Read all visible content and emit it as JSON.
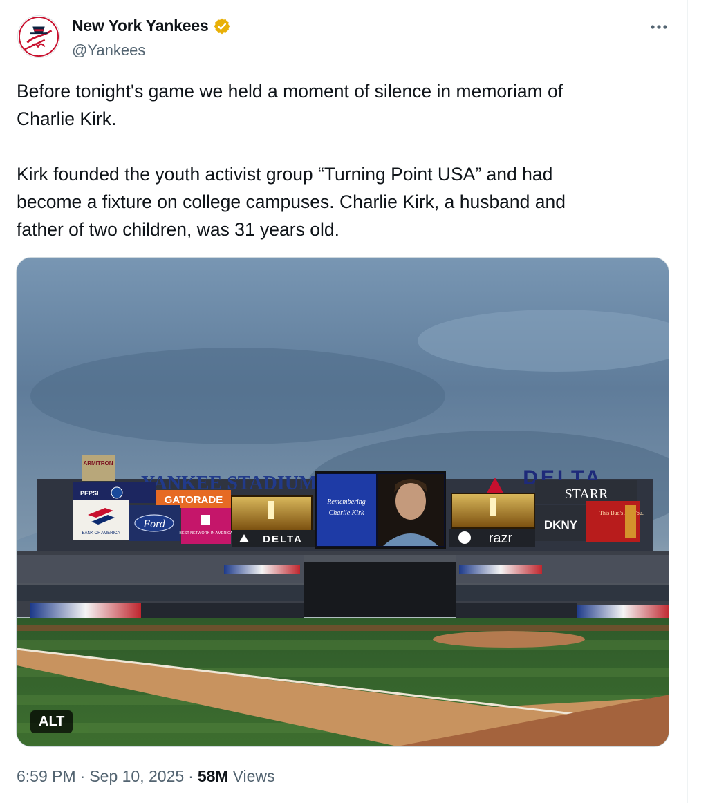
{
  "author": {
    "display_name": "New York Yankees",
    "handle": "@Yankees",
    "verified_color": "#e8b007",
    "avatar_icon": "yankees-logo"
  },
  "tweet": {
    "paragraphs": [
      "Before tonight's game we held a moment of silence in memoriam of\nCharlie Kirk.",
      "Kirk founded the youth activist group “Turning Point USA” and had\nbecome a fixture on college campuses. Charlie Kirk, a husband and\nfather of two children, was 31 years old."
    ]
  },
  "media": {
    "alt_label": "ALT",
    "scene_text": {
      "stadium_sign": "YANKEE STADIUM",
      "delta_sign": "DELTA",
      "starr_sign": "STARR",
      "center_screen_line1": "Remembering",
      "center_screen_line2": "Charlie Kirk",
      "gatorade": "GATORADE",
      "ford": "Ford",
      "bank": "BANK OF AMERICA",
      "pepsi": "PEPSI",
      "delta_small": "DELTA",
      "razr": "razr",
      "dkny": "DKNY",
      "buds": "This Bud's For You.",
      "armitron": "ARMITRON",
      "tmobile": "BEST NETWORK IN AMERICA"
    }
  },
  "meta": {
    "time": "6:59 PM",
    "date": "Sep 10, 2025",
    "separator": "·",
    "views_count": "58M",
    "views_label": "Views"
  },
  "colors": {
    "text_primary": "#0f1419",
    "text_secondary": "#536471",
    "yankees_navy": "#0c2340",
    "yankees_red": "#c8102e"
  }
}
